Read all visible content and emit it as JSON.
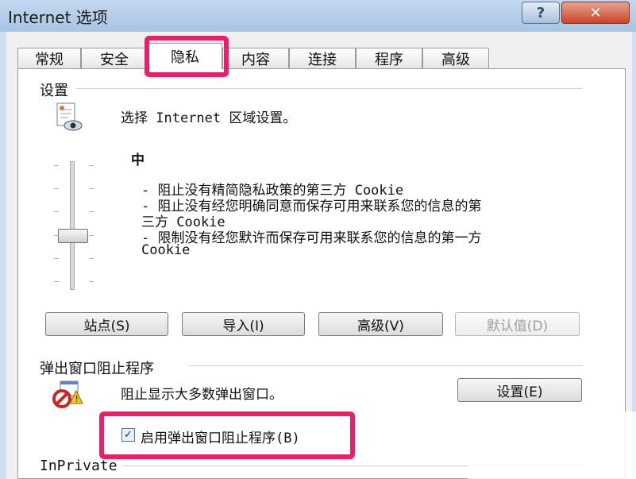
{
  "window": {
    "title": "Internet 选项",
    "help_button": "?",
    "close_button": "✕"
  },
  "tabs": [
    {
      "label": "常规"
    },
    {
      "label": "安全"
    },
    {
      "label": "隐私"
    },
    {
      "label": "内容"
    },
    {
      "label": "连接"
    },
    {
      "label": "程序"
    },
    {
      "label": "高级"
    }
  ],
  "active_tab": "隐私",
  "settings": {
    "group_label": "设置",
    "description": "选择 Internet 区域设置。",
    "level": "中",
    "bullets": [
      "- 阻止没有精简隐私政策的第三方 Cookie",
      "- 阻止没有经您明确同意而保存可用来联系您的信息的第",
      "三方 Cookie",
      "- 限制没有经您默许而保存可用来联系您的信息的第一方",
      "Cookie"
    ],
    "buttons": {
      "sites": "站点(S)",
      "import": "导入(I)",
      "advanced": "高级(V)",
      "default": "默认值(D)"
    },
    "default_enabled": false
  },
  "popup": {
    "group_label": "弹出窗口阻止程序",
    "description": "阻止显示大多数弹出窗口。",
    "settings_button": "设置(E)",
    "enable_checkbox_label": "启用弹出窗口阻止程序(B)",
    "enabled": true
  },
  "inprivate": {
    "group_label": "InPrivate"
  },
  "colors": {
    "highlight": "#e8206a",
    "titlebar": "#a9c4e4",
    "close_button": "#c94426"
  }
}
